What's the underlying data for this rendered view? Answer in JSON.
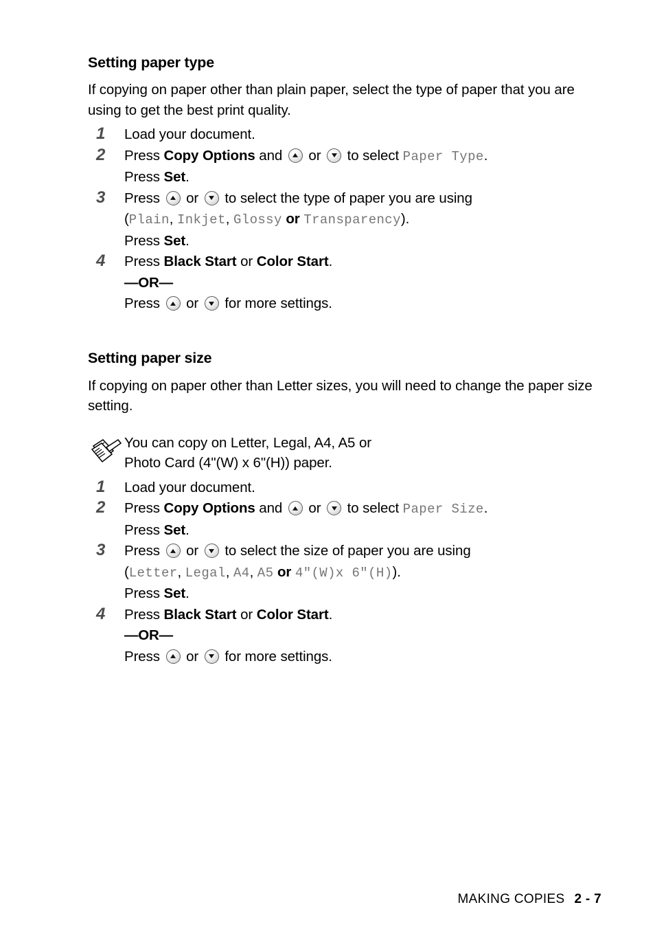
{
  "page": {
    "footer": {
      "chapter_label": "MAKING COPIES",
      "page_number": "2 - 7"
    }
  },
  "sections": [
    {
      "heading": "Setting paper type",
      "intro": "If copying on paper other than plain paper, select the type of paper that you are using to get the best print quality.",
      "steps": [
        {
          "number": "1",
          "text": "Load your document."
        },
        {
          "number": "2",
          "press_label": "Press ",
          "button": "Copy Options",
          "and_label": " and ",
          "or_label": " or ",
          "select_label": " to select ",
          "lcd_value": "Paper Type",
          "period": ".",
          "sub": "Press ",
          "sub_bold": "Set",
          "sub_end": "."
        },
        {
          "number": "3",
          "press_label": "Press ",
          "or_label": " or ",
          "select_label": " to select the type of paper you are using",
          "open_paren": "(",
          "options": [
            "Plain",
            "Inkjet",
            "Glossy",
            "Transparency"
          ],
          "comma": ", ",
          "or_word": " or ",
          "close_paren": ").",
          "sub": "Press ",
          "sub_bold": "Set",
          "sub_end": "."
        },
        {
          "number": "4",
          "press_label": "Press ",
          "black_start": "Black Start",
          "or_label": " or ",
          "color_start": "Color Start",
          "period": ".",
          "or_rule": "—OR—",
          "alt_press": "Press ",
          "alt_or": " or ",
          "alt_end": " for more settings."
        }
      ]
    },
    {
      "heading": "Setting paper size",
      "intro": "If copying on paper other than Letter sizes, you will need to change the paper size setting.",
      "note": {
        "icon": "notepad-pencil-icon",
        "line1": "You can copy on Letter, Legal, A4, A5 or",
        "line2": "Photo Card (4\"(W) x 6\"(H)) paper."
      },
      "steps": [
        {
          "number": "1",
          "text": "Load your document."
        },
        {
          "number": "2",
          "press_label": "Press ",
          "button": "Copy Options",
          "and_label": " and ",
          "or_label": " or ",
          "select_label": " to select ",
          "lcd_value": "Paper Size",
          "period": ".",
          "sub": "Press ",
          "sub_bold": "Set",
          "sub_end": "."
        },
        {
          "number": "3",
          "press_label": "Press ",
          "or_label": " or ",
          "select_label": " to select the size of paper you are using",
          "open_paren": "(",
          "options": [
            "Letter",
            "Legal",
            "A4",
            "A5",
            "4″(W)x 6″(H)"
          ],
          "comma": ", ",
          "or_word": " or ",
          "close_paren": ").",
          "sub": "Press ",
          "sub_bold": "Set",
          "sub_end": "."
        },
        {
          "number": "4",
          "press_label": "Press ",
          "black_start": "Black Start",
          "or_label": " or ",
          "color_start": "Color Start",
          "period": ".",
          "or_rule": "—OR—",
          "alt_press": "Press ",
          "alt_or": " or ",
          "alt_end": " for more settings."
        }
      ]
    }
  ]
}
